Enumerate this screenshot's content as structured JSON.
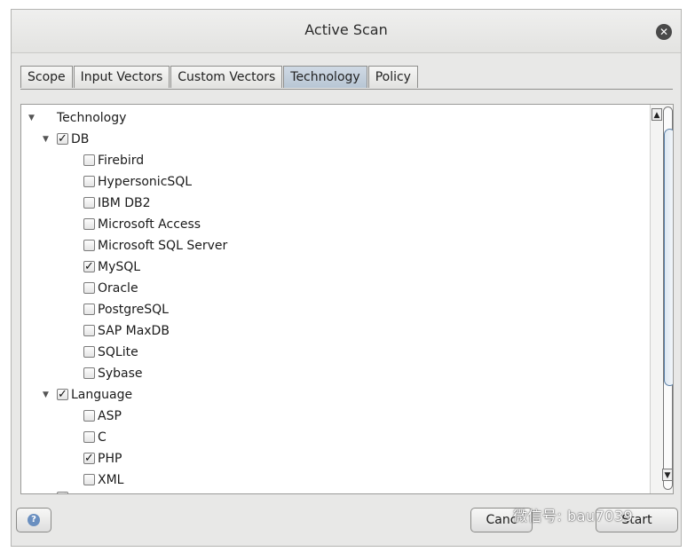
{
  "window": {
    "title": "Active Scan"
  },
  "tabs": [
    {
      "label": "Scope",
      "active": false
    },
    {
      "label": "Input Vectors",
      "active": false
    },
    {
      "label": "Custom Vectors",
      "active": false
    },
    {
      "label": "Technology",
      "active": true
    },
    {
      "label": "Policy",
      "active": false
    }
  ],
  "tree": {
    "root": {
      "label": "Technology",
      "expanded": true
    },
    "groups": [
      {
        "label": "DB",
        "checked": true,
        "expanded": true,
        "items": [
          {
            "label": "Firebird",
            "checked": false
          },
          {
            "label": "HypersonicSQL",
            "checked": false
          },
          {
            "label": "IBM DB2",
            "checked": false
          },
          {
            "label": "Microsoft Access",
            "checked": false
          },
          {
            "label": "Microsoft SQL Server",
            "checked": false
          },
          {
            "label": "MySQL",
            "checked": true
          },
          {
            "label": "Oracle",
            "checked": false
          },
          {
            "label": "PostgreSQL",
            "checked": false
          },
          {
            "label": "SAP MaxDB",
            "checked": false
          },
          {
            "label": "SQLite",
            "checked": false
          },
          {
            "label": "Sybase",
            "checked": false
          }
        ]
      },
      {
        "label": "Language",
        "checked": true,
        "expanded": true,
        "items": [
          {
            "label": "ASP",
            "checked": false
          },
          {
            "label": "C",
            "checked": false
          },
          {
            "label": "PHP",
            "checked": true
          },
          {
            "label": "XML",
            "checked": false
          }
        ]
      }
    ]
  },
  "footer": {
    "help_icon": "question-icon",
    "cancel_label": "Canc",
    "start_label": "Start"
  },
  "watermark": "微信号: bau7039",
  "icons": {
    "close": "close-icon",
    "expand": "triangle-down-icon"
  },
  "colors": {
    "active_tab": "#c3cfdc",
    "scroll_thumb_border": "#5a7fa6"
  }
}
